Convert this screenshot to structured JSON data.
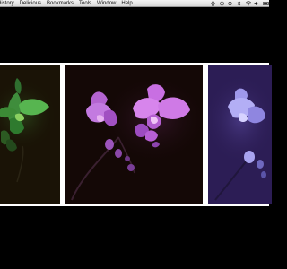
{
  "menubar": {
    "items": [
      {
        "label": "History"
      },
      {
        "label": "Delicious"
      },
      {
        "label": "Bookmarks"
      },
      {
        "label": "Tools"
      },
      {
        "label": "Window"
      },
      {
        "label": "Help"
      }
    ],
    "status": {
      "icons": [
        "shift-indicator-icon",
        "clock-icon",
        "sync-icon",
        "bluetooth-icon",
        "wifi-icon",
        "volume-icon",
        "battery-icon"
      ]
    }
  },
  "gallery": {
    "images": [
      {
        "subject": "orchid",
        "tint": "green"
      },
      {
        "subject": "orchid",
        "tint": "magenta"
      },
      {
        "subject": "orchid",
        "tint": "blue-violet"
      }
    ]
  },
  "colors": {
    "menubar_bg": "#e6e6e6",
    "page_bg": "#000000",
    "band": "#ffffff",
    "orchid_green": "#4fa84a",
    "orchid_magenta": "#c56ee0",
    "orchid_blue": "#a9a4f0"
  }
}
